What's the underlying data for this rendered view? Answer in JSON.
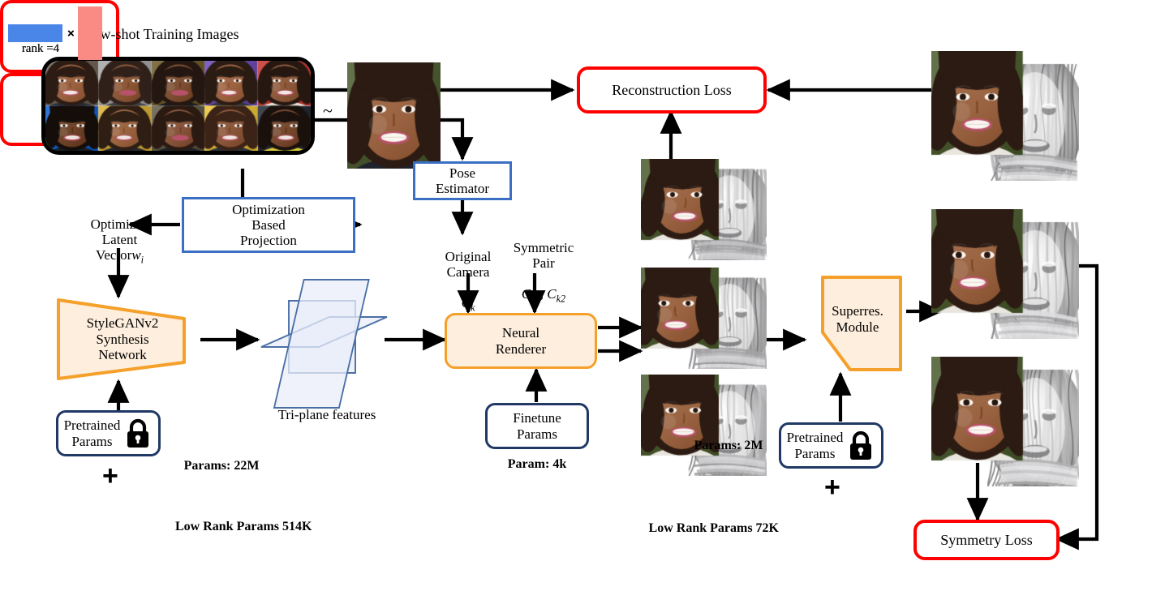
{
  "figure": {
    "title": "Few-shot Training Images",
    "tilde": "~"
  },
  "boxes": {
    "optimization_projection": "Optimization\nBased\nProjection",
    "pose_estimator": "Pose\nEstimator",
    "stylegan": "StyleGANv2\nSynthesis\nNetwork",
    "neural_renderer": "Neural\nRenderer",
    "superres": "Superres.\nModule",
    "pretrained_params_left": "Pretrained\nParams",
    "pretrained_params_right": "Pretrained\nParams",
    "finetune_params": "Finetune\nParams",
    "reconstruction_loss": "Reconstruction Loss",
    "symmetry_loss": "Symmetry Loss"
  },
  "labels": {
    "optimized_latent_vector": "Optimized\nLatent\nVector",
    "optimized_latent_symbol": "w",
    "optimized_latent_sub": "i",
    "original_camera": "Original\nCamera",
    "original_camera_symbol": "C",
    "original_camera_sub": "k",
    "symmetric_pair": "Symmetric\nPair",
    "symmetric_pair_symbol_1": "C",
    "symmetric_pair_sub_1": "k1",
    "symmetric_pair_symbol_2": "C",
    "symmetric_pair_sub_2": "k2",
    "triplane": "Tri-plane features",
    "params_22m": "Params: 22M",
    "param_4k": "Param: 4k",
    "params_2m": "Params: 2M",
    "low_rank_514k": "Low Rank Params 514K",
    "low_rank_72k": "Low Rank Params 72K",
    "rank_left": "rank =4",
    "rank_right": "rank =4",
    "multiply": "×",
    "plus_left": "+",
    "plus_right": "+"
  },
  "icons": {
    "lock_left": "lock-icon",
    "lock_right": "lock-icon"
  },
  "colors": {
    "blue_box": "#3b6fc4",
    "navy_box": "#1f3864",
    "red_box": "#ff0000",
    "orange_stroke": "#f5a02a",
    "orange_fill": "#fdeedd",
    "plane_stroke": "#4a6fa5",
    "plane_fill": "#e9eef9",
    "bar_blue": "#4a86e8",
    "bar_red": "#f98a84",
    "arrow": "#000000"
  },
  "thumbnails": {
    "few_shot_count": 10,
    "sampled_image": "sampled-training-image",
    "renderer_outputs": 3,
    "superres_outputs": 3
  }
}
